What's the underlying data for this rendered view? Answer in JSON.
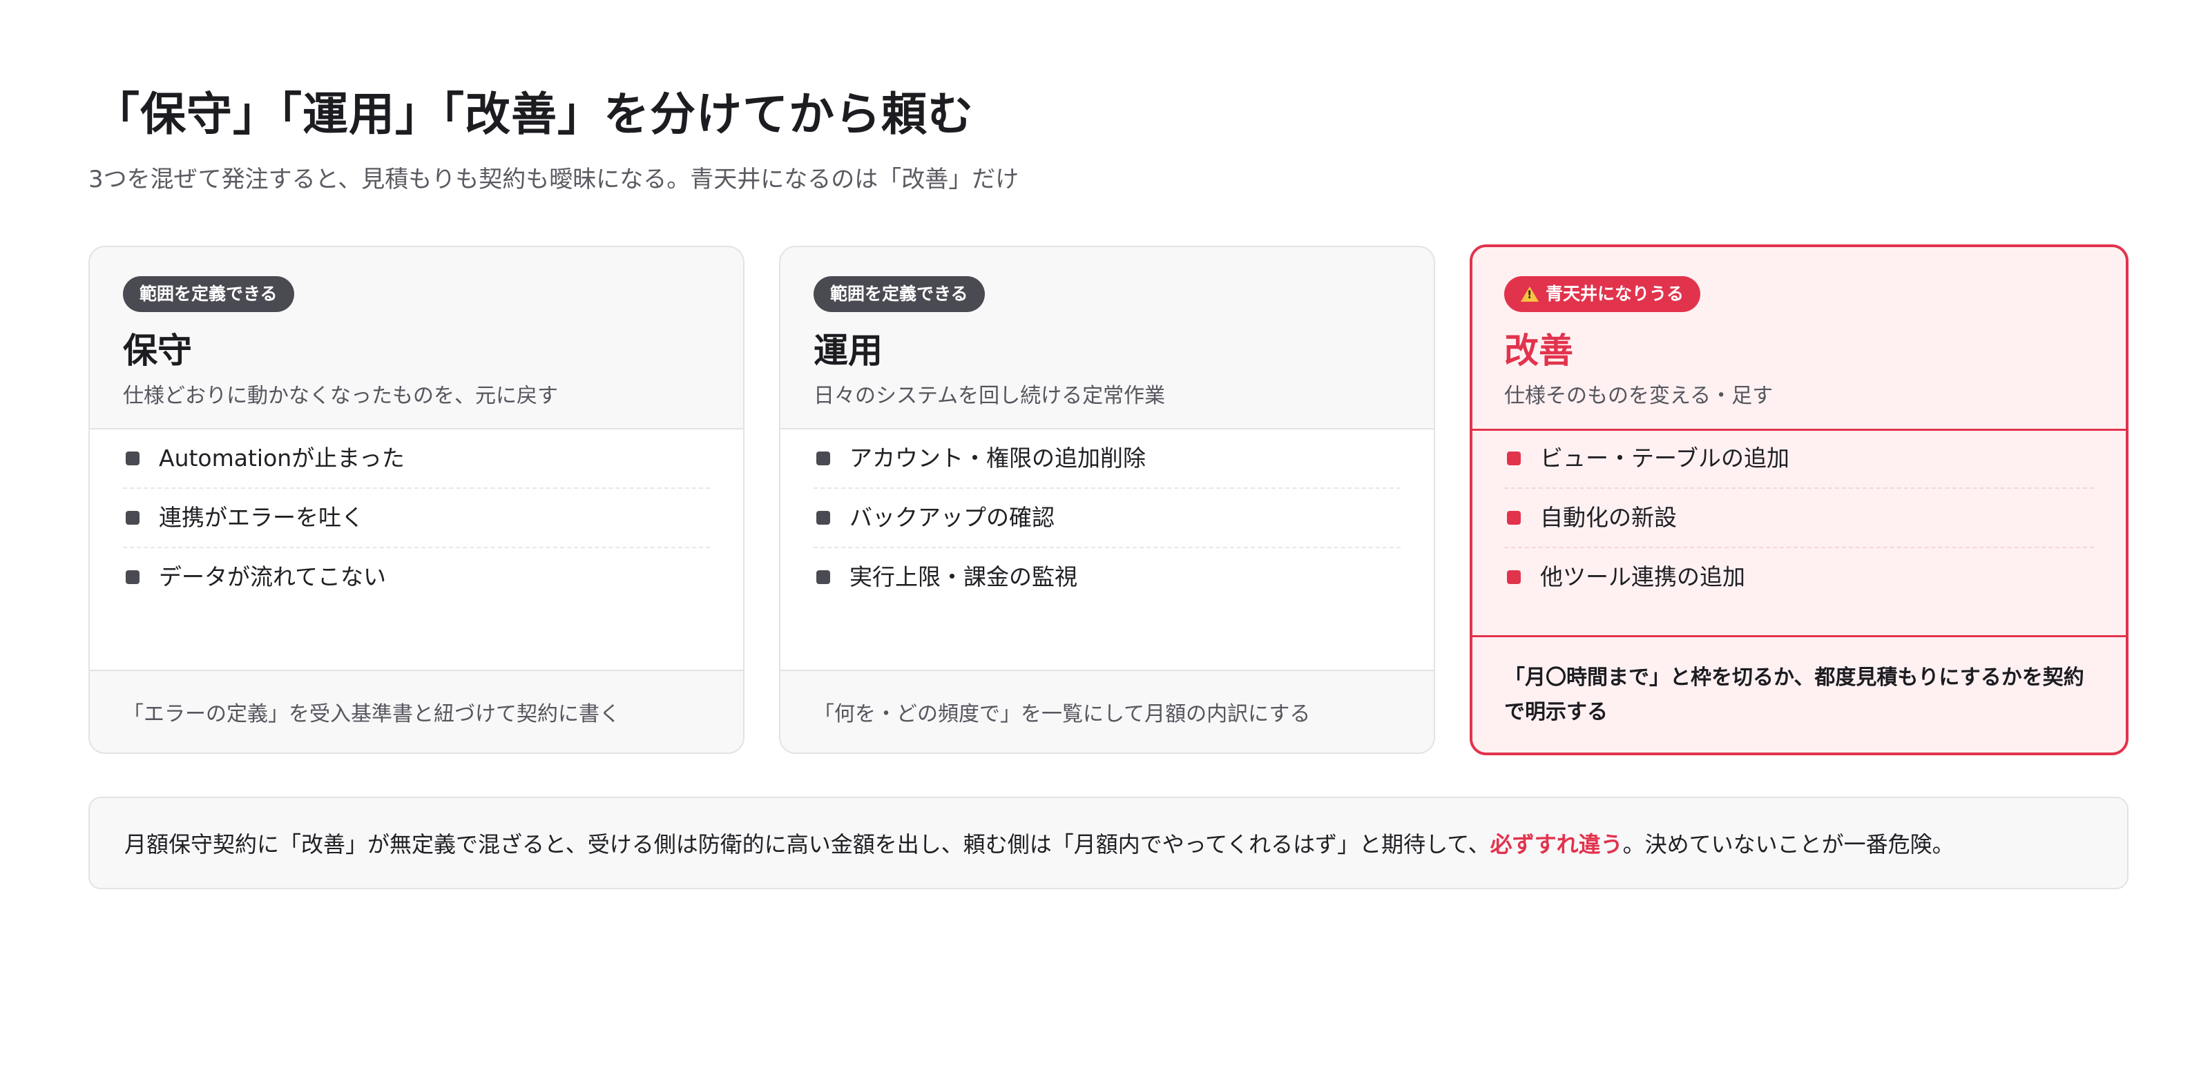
{
  "header": {
    "title": "「保守」「運用」「改善」を分けてから頼む",
    "subtitle": "3つを混ぜて発注すると、見積もりも契約も曖昧になる。青天井になるのは「改善」だけ"
  },
  "cards": [
    {
      "badge": "範囲を定義できる",
      "title": "保守",
      "description": "仕様どおりに動かなくなったものを、元に戻す",
      "items": [
        "Automationが止まった",
        "連携がエラーを吐く",
        "データが流れてこない"
      ],
      "footer": "「エラーの定義」を受入基準書と紐づけて契約に書く"
    },
    {
      "badge": "範囲を定義できる",
      "title": "運用",
      "description": "日々のシステムを回し続ける定常作業",
      "items": [
        "アカウント・権限の追加削除",
        "バックアップの確認",
        "実行上限・課金の監視"
      ],
      "footer": "「何を・どの頻度で」を一覧にして月額の内訳にする"
    },
    {
      "badge": "青天井になりうる",
      "badge_icon": "warning-icon",
      "title": "改善",
      "description": "仕様そのものを変える・足す",
      "items": [
        "ビュー・テーブルの追加",
        "自動化の新設",
        "他ツール連携の追加"
      ],
      "footer": "「月〇時間まで」と枠を切るか、都度見積もりにするかを契約で明示する"
    }
  ],
  "note": {
    "text_before": "月額保守契約に「改善」が無定義で混ざると、受ける側は防衛的に高い金額を出し、頼む側は「月額内でやってくれるはず」と期待して、",
    "highlight": "必ずすれ違う",
    "text_after": "。決めていないことが一番危険。"
  },
  "colors": {
    "accent": "#e2334d",
    "badge_neutral": "#4a4a52",
    "card_tint": "#fff1f2"
  }
}
